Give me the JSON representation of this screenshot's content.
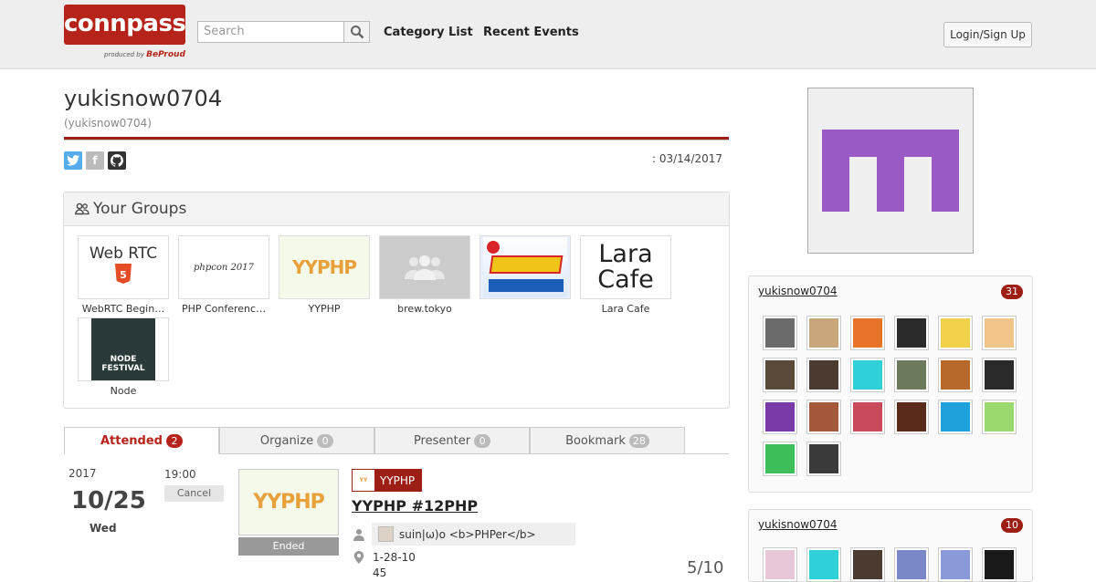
{
  "header": {
    "logo_text": "connpass",
    "logo_sub": "produced by",
    "logo_brand": "BeProud",
    "search_placeholder": "Search",
    "nav": [
      "Category List",
      "Recent Events"
    ],
    "login_label": "Login/Sign Up"
  },
  "profile": {
    "display_name": "yukisnow0704",
    "username": "(yukisnow0704)",
    "joined": ": 03/14/2017",
    "social": [
      "twitter-icon",
      "facebook-icon",
      "github-icon"
    ]
  },
  "groups": {
    "title": "Your Groups",
    "items": [
      {
        "label": "WebRTC Begin…",
        "thumb": "Web RTC"
      },
      {
        "label": "PHP Conferenc…",
        "thumb": "phpcon 2017"
      },
      {
        "label": "YYPHP",
        "thumb": "YYPHP"
      },
      {
        "label": "brew.tokyo",
        "thumb": ""
      },
      {
        "label": "",
        "thumb": ""
      },
      {
        "label": "Lara Cafe",
        "thumb": "Lara Cafe"
      },
      {
        "label": "Node",
        "thumb": "NODE FESTIVAL"
      }
    ]
  },
  "tabs": [
    {
      "label": "Attended",
      "count": "2"
    },
    {
      "label": "Organize",
      "count": "0"
    },
    {
      "label": "Presenter",
      "count": "0"
    },
    {
      "label": "Bookmark",
      "count": "28"
    }
  ],
  "event": {
    "year": "2017",
    "date": "10/25",
    "dow": "Wed",
    "time": "19:00",
    "cancel_label": "Cancel",
    "status": "Ended",
    "group_tag": "YYPHP",
    "title": "YYPHP #12PHP",
    "presenter": "suin|ω)o <b>PHPer</b>",
    "address_line1": "1-28-10",
    "address_line2": "45",
    "capacity": "5/10",
    "thumb_text": "YYPHP"
  },
  "sidebar": {
    "boxes": [
      {
        "title": "yukisnow0704",
        "count": "31"
      },
      {
        "title": "yukisnow0704",
        "count": "10"
      }
    ]
  },
  "colors": {
    "brand_red": "#b6231a",
    "identicon": "#9b59c6"
  }
}
